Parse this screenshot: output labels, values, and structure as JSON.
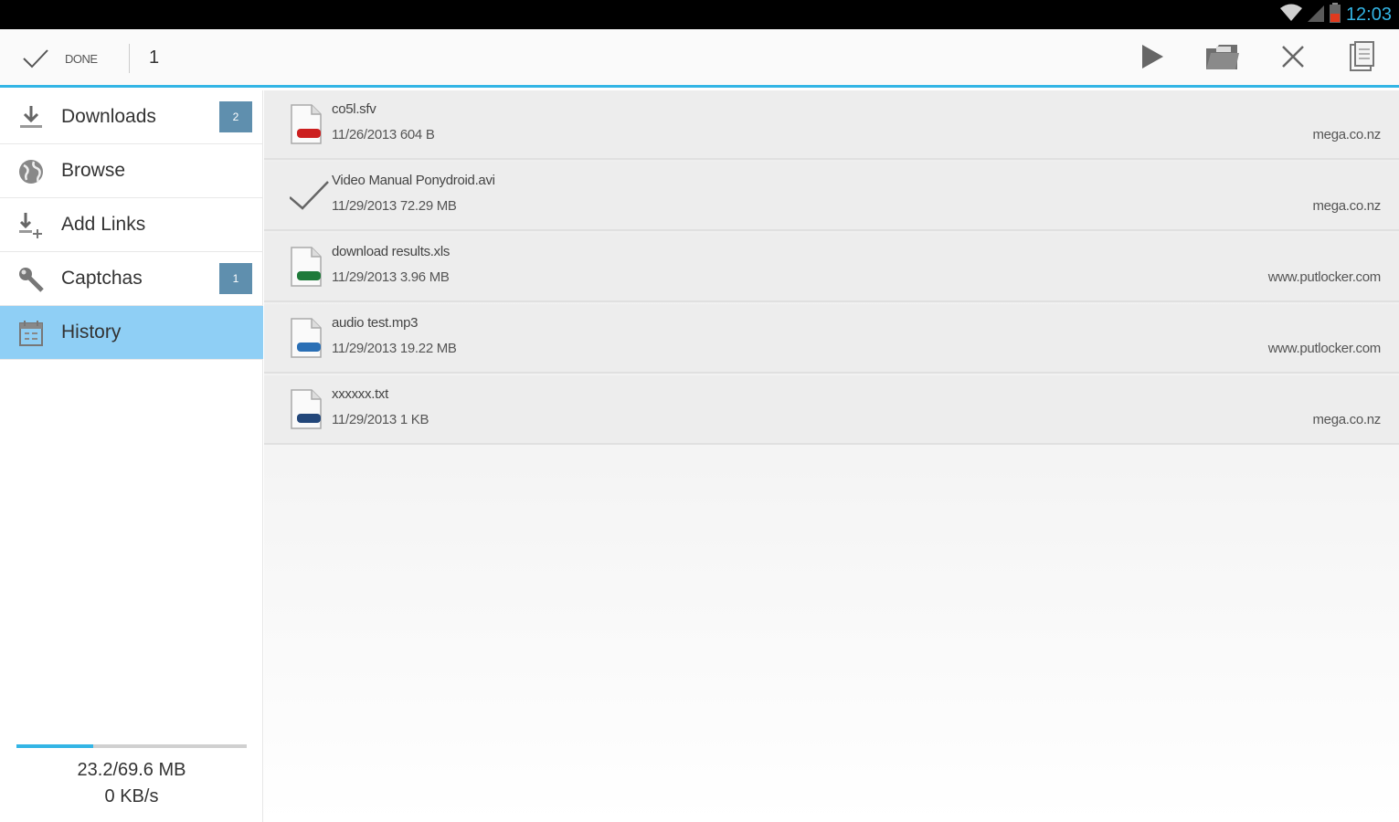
{
  "status_bar": {
    "time": "12:03",
    "accent": "#33b5e5"
  },
  "action_bar": {
    "done_label": "DONE",
    "selected_count": "1",
    "actions": [
      "play-icon",
      "open-folder-icon",
      "close-icon",
      "copy-icon"
    ]
  },
  "sidebar": {
    "items": [
      {
        "label": "Downloads",
        "icon": "download-icon",
        "badge": "2"
      },
      {
        "label": "Browse",
        "icon": "globe-icon",
        "badge": ""
      },
      {
        "label": "Add Links",
        "icon": "add-link-icon",
        "badge": ""
      },
      {
        "label": "Captchas",
        "icon": "key-icon",
        "badge": "1"
      },
      {
        "label": "History",
        "icon": "history-icon",
        "badge": "",
        "active": true
      }
    ],
    "progress": {
      "fraction": 0.333,
      "size_text": "23.2/69.6 MB",
      "speed_text": "0 KB/s"
    }
  },
  "files": [
    {
      "name": "co5l.sfv",
      "meta": "11/26/2013  604 B",
      "host": "mega.co.nz",
      "icon": "file-sfv-icon",
      "tag_color": "#cc1f1f",
      "checked": false
    },
    {
      "name": "Video Manual Ponydroid.avi",
      "meta": "11/29/2013  72.29 MB",
      "host": "mega.co.nz",
      "icon": "check-icon",
      "tag_color": "",
      "checked": true
    },
    {
      "name": "download results.xls",
      "meta": "11/29/2013  3.96 MB",
      "host": "www.putlocker.com",
      "icon": "file-xls-icon",
      "tag_color": "#1f7a3a",
      "checked": false
    },
    {
      "name": "audio test.mp3",
      "meta": "11/29/2013  19.22 MB",
      "host": "www.putlocker.com",
      "icon": "file-mp3-icon",
      "tag_color": "#2a6fb5",
      "checked": false
    },
    {
      "name": "xxxxxx.txt",
      "meta": "11/29/2013  1 KB",
      "host": "mega.co.nz",
      "icon": "file-txt-icon",
      "tag_color": "#23477a",
      "checked": false
    }
  ]
}
